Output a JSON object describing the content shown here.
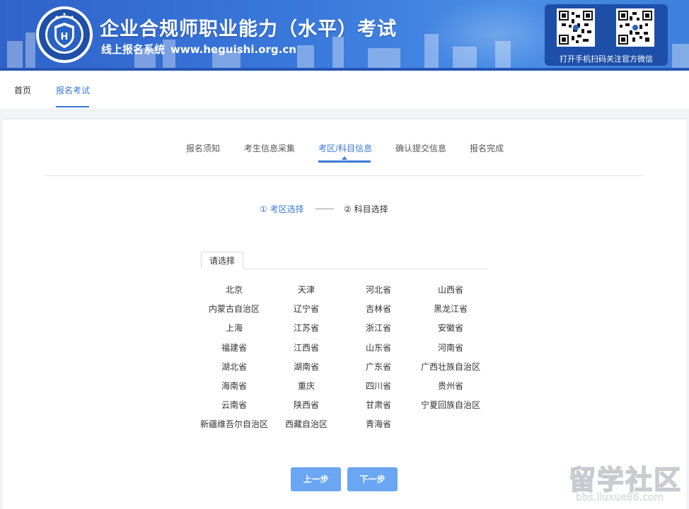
{
  "banner": {
    "title": "企业合规师职业能力（水平）考试",
    "subtitle": "线上报名系统",
    "url": "www.heguishi.org.cn",
    "qr_caption": "打开手机扫码关注官方微信"
  },
  "nav": {
    "home": "首页",
    "register": "报名考试"
  },
  "steps": [
    "报名须知",
    "考生信息采集",
    "考区/科目信息",
    "确认提交信息",
    "报名完成"
  ],
  "substeps": {
    "first": "① 考区选择",
    "second": "② 科目选择"
  },
  "tab_label": "请选择",
  "regions": [
    "北京",
    "天津",
    "河北省",
    "山西省",
    "内蒙古自治区",
    "辽宁省",
    "吉林省",
    "黑龙江省",
    "上海",
    "江苏省",
    "浙江省",
    "安徽省",
    "福建省",
    "江西省",
    "山东省",
    "河南省",
    "湖北省",
    "湖南省",
    "广东省",
    "广西壮族自治区",
    "海南省",
    "重庆",
    "四川省",
    "贵州省",
    "云南省",
    "陕西省",
    "甘肃省",
    "宁夏回族自治区",
    "新疆维吾尔自治区",
    "西藏自治区",
    "青海省"
  ],
  "buttons": {
    "prev": "上一步",
    "next": "下一步"
  },
  "watermark": {
    "main": "留学社区",
    "sub": "bbs.liuxue86.com"
  },
  "colors": {
    "accent": "#3b78d8",
    "button": "#6aa6f2",
    "banner": "#3a79dc"
  }
}
